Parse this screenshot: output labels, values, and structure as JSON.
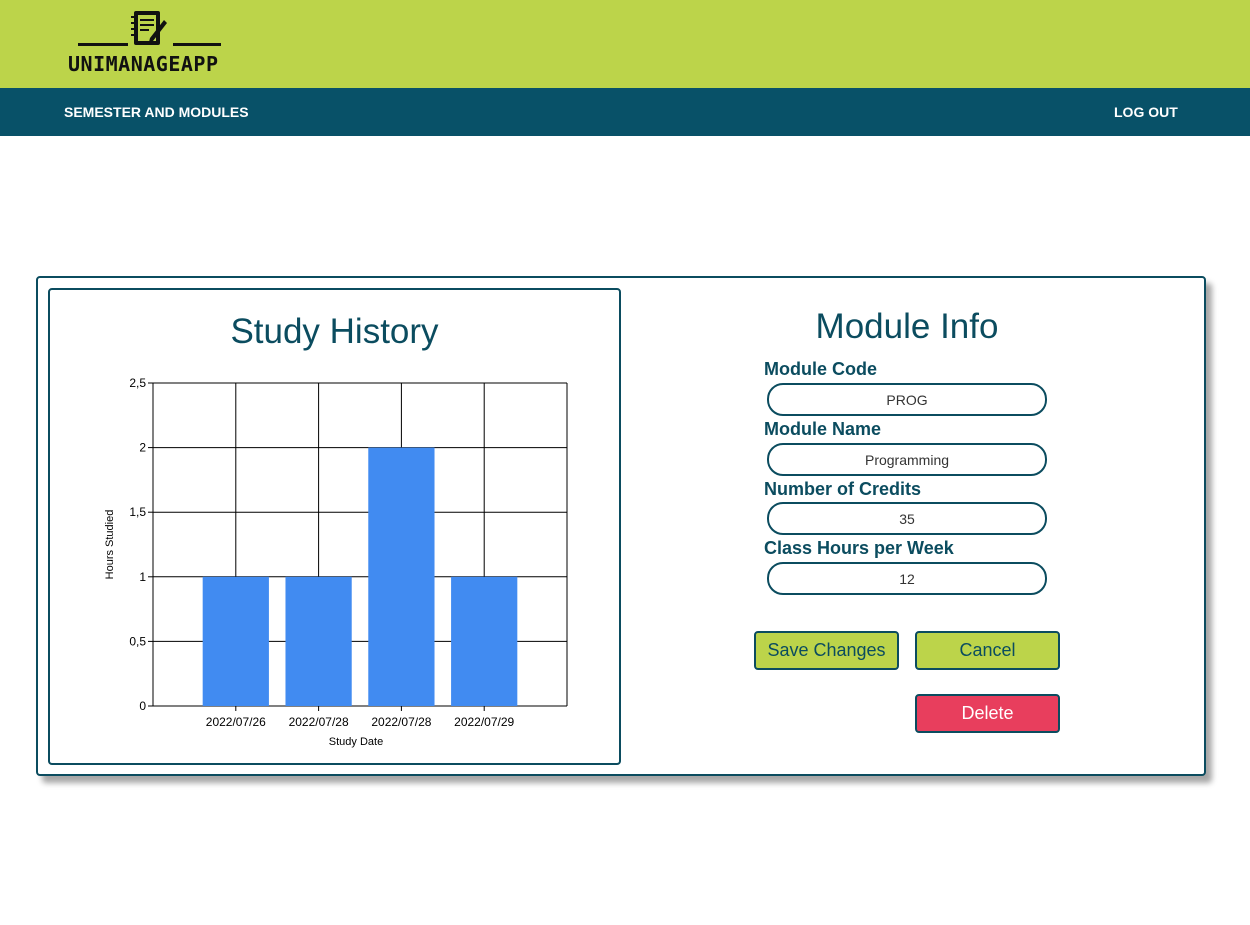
{
  "app": {
    "logo_text": "UNIMANAGEAPP",
    "colors": {
      "brand_green": "#bcd44a",
      "nav_teal": "#085168",
      "accent_dark": "#0b4c5f",
      "bar_blue": "#418bf1",
      "danger": "#e83e5d"
    }
  },
  "nav": {
    "semester_modules": "SEMESTER AND MODULES",
    "logout": "LOG OUT"
  },
  "history": {
    "title": "Study History"
  },
  "chart_data": {
    "type": "bar",
    "categories": [
      "2022/07/26",
      "2022/07/28",
      "2022/07/28",
      "2022/07/29"
    ],
    "values": [
      1,
      1,
      2,
      1
    ],
    "xlabel": "Study Date",
    "ylabel": "Hours Studied",
    "ylim": [
      0,
      2.5
    ],
    "yticks": [
      "0",
      "0,5",
      "1",
      "1,5",
      "2",
      "2,5"
    ],
    "grid": true,
    "bar_color": "#418bf1"
  },
  "module": {
    "title": "Module Info",
    "code_label": "Module Code",
    "code_value": "PROG",
    "name_label": "Module Name",
    "name_value": "Programming",
    "credits_label": "Number of Credits",
    "credits_value": "35",
    "hours_label": "Class Hours per Week",
    "hours_value": "12"
  },
  "actions": {
    "save": "Save Changes",
    "cancel": "Cancel",
    "delete": "Delete"
  }
}
